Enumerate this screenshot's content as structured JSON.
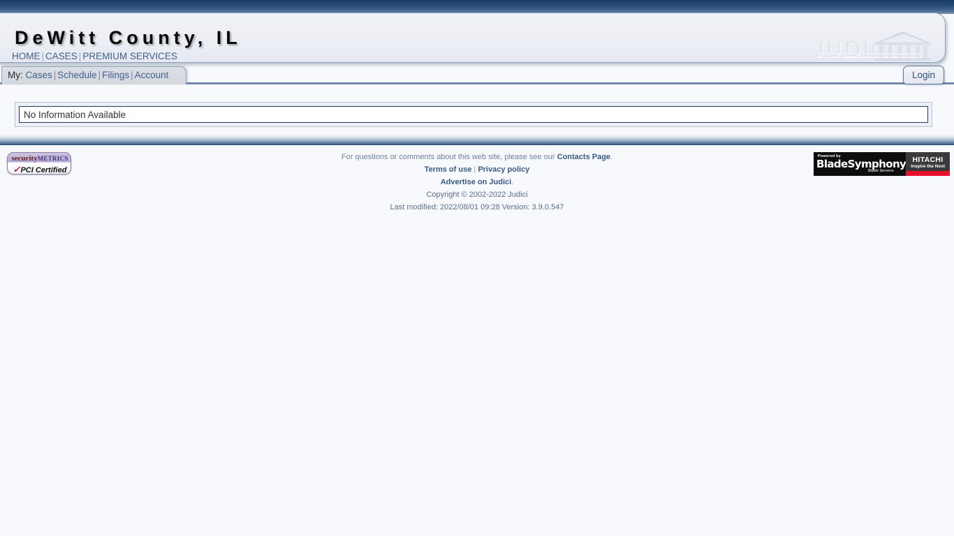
{
  "header": {
    "site_title": "DeWitt County, IL",
    "nav": [
      {
        "label": "HOME"
      },
      {
        "label": "CASES"
      },
      {
        "label": "PREMIUM SERVICES"
      }
    ],
    "separator": "|",
    "logo_text": "JUDICI",
    "logo_icon": "courthouse-icon"
  },
  "tabbar": {
    "my_label": "My:",
    "items": [
      {
        "label": "Cases"
      },
      {
        "label": "Schedule"
      },
      {
        "label": "Filings"
      },
      {
        "label": "Account"
      }
    ],
    "separator": "|",
    "login_label": "Login"
  },
  "main": {
    "message": "No Information Available"
  },
  "footer": {
    "line1_prefix": "For questions or comments about this web site, please see our ",
    "line1_link": "Contacts Page",
    "line1_suffix": ".",
    "terms_label": "Terms of use",
    "privacy_label": "Privacy policy",
    "separator": "|",
    "advertise_label": "Advertise on Judici",
    "advertise_suffix": ".",
    "copyright": "Copyright © 2002-2022 Judici",
    "last_modified": "Last modified: 2022/08/01 09:28 Version: 3.9.0.547"
  },
  "badges": {
    "securitymetrics": {
      "brand_first": "security",
      "brand_second": "METRICS",
      "check": "✓",
      "certified": "PCI Certified"
    },
    "bladesymphony": {
      "powered_by": "Powered by",
      "product": "BladeSymphony",
      "sub": "Blade Servers",
      "vendor": "HITACHI",
      "tagline": "Inspire the Next"
    }
  },
  "colors": {
    "navy": "#1b3a63",
    "link_blue": "#41618e",
    "page_bg": "#f8f9fc",
    "accent_red": "#e8112d"
  }
}
